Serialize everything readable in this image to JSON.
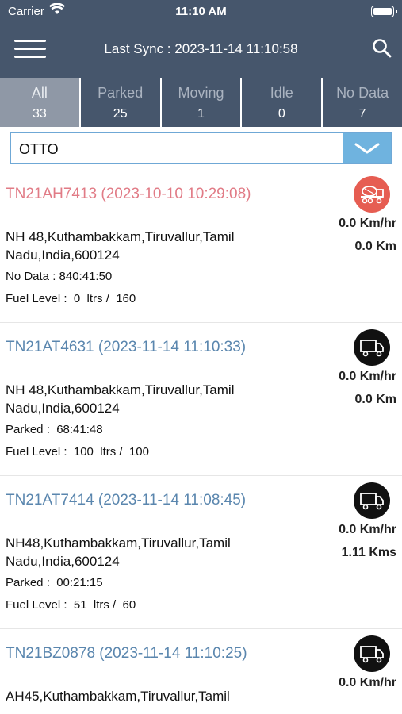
{
  "status_bar": {
    "carrier": "Carrier",
    "time": "11:10 AM"
  },
  "header": {
    "title": "Last Sync : 2023-11-14 11:10:58"
  },
  "tabs": [
    {
      "label": "All",
      "count": "33"
    },
    {
      "label": "Parked",
      "count": "25"
    },
    {
      "label": "Moving",
      "count": "1"
    },
    {
      "label": "Idle",
      "count": "0"
    },
    {
      "label": "No Data",
      "count": "7"
    }
  ],
  "filter": {
    "value": "OTTO"
  },
  "vehicles": [
    {
      "title": "TN21AH7413 (2023-10-10 10:29:08)",
      "speed": "0.0 Km/hr",
      "distance": "0.0 Km",
      "address": "NH 48,Kuthambakkam,Tiruvallur,Tamil Nadu,India,600124",
      "status": "No Data : 840:41:50",
      "fuel": "Fuel Level :  0  ltrs /  160",
      "icon": "concrete-mixer-truck-icon",
      "icon_color": "#e65d52"
    },
    {
      "title": "TN21AT4631 (2023-11-14 11:10:33)",
      "speed": "0.0 Km/hr",
      "distance": "0.0 Km",
      "address": "NH 48,Kuthambakkam,Tiruvallur,Tamil Nadu,India,600124",
      "status": "Parked :  68:41:48",
      "fuel": "Fuel Level :  100  ltrs /  100",
      "icon": "truck-icon",
      "icon_color": "#111111"
    },
    {
      "title": "TN21AT7414 (2023-11-14 11:08:45)",
      "speed": "0.0 Km/hr",
      "distance": "1.11 Kms",
      "address": "NH48,Kuthambakkam,Tiruvallur,Tamil Nadu,India,600124",
      "status": "Parked :  00:21:15",
      "fuel": "Fuel Level :  51  ltrs /  60",
      "icon": "truck-icon",
      "icon_color": "#111111"
    },
    {
      "title": "TN21BZ0878 (2023-11-14 11:10:25)",
      "speed": "0.0 Km/hr",
      "distance": "",
      "address": "AH45,Kuthambakkam,Tiruvallur,Tamil",
      "status": "",
      "fuel": "",
      "icon": "truck-icon",
      "icon_color": "#111111"
    }
  ],
  "colors": {
    "header_bg": "#46566c",
    "active_tab_bg": "#8f98a6",
    "link_blue": "#5a86ae",
    "alert_pink": "#e17b86",
    "dropdown_btn": "#6fb3df"
  }
}
